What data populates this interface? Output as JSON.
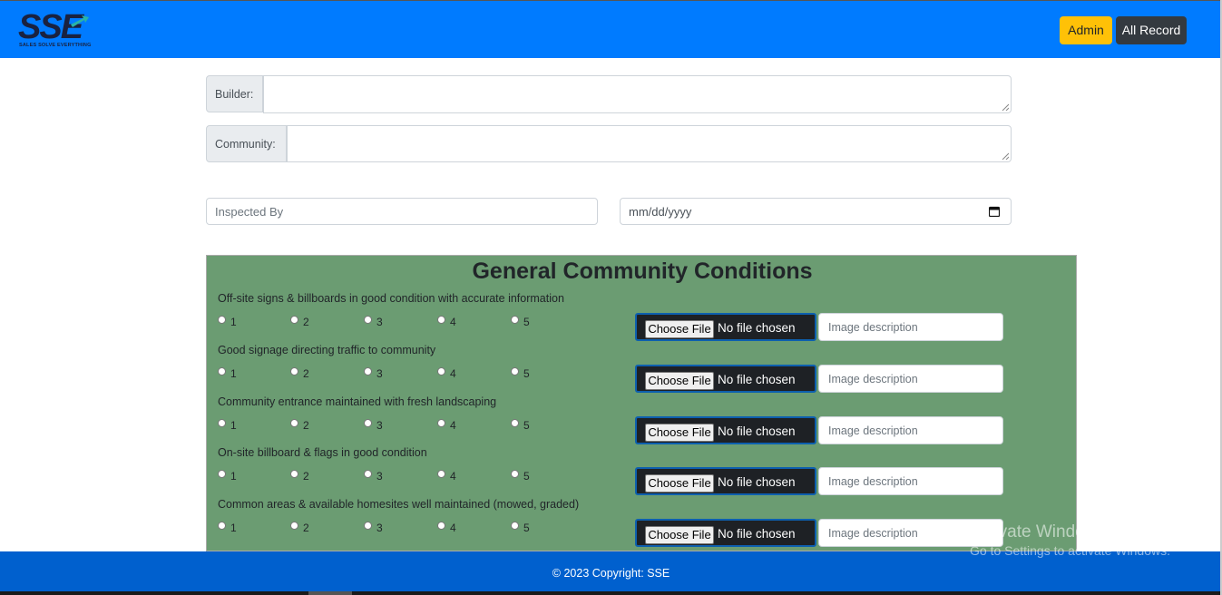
{
  "header": {
    "logo_text": "SSE",
    "logo_tagline": "SALES SOLVE EVERYTHING",
    "admin_label": "Admin",
    "all_record_label": "All Record"
  },
  "form": {
    "builder_label": "Builder:",
    "community_label": "Community:",
    "inspected_by_placeholder": "Inspected By",
    "date_placeholder": "mm/dd/yyyy"
  },
  "section": {
    "title": "General Community Conditions",
    "rating_options": [
      "1",
      "2",
      "3",
      "4",
      "5"
    ],
    "file_button_label": "Choose File",
    "file_status": "No file chosen",
    "image_desc_placeholder": "Image description",
    "questions": [
      "Off-site signs & billboards in good condition with accurate information",
      "Good signage directing traffic to community",
      "Community entrance maintained with fresh landscaping",
      "On-site billboard & flags in good condition",
      "Common areas & available homesites well maintained (mowed, graded)"
    ]
  },
  "footer": {
    "copyright": "© 2023 Copyright: SSE"
  },
  "watermark": {
    "line1": "Activate Windows",
    "line2": "Go to Settings to activate Windows."
  },
  "colors": {
    "navbar": "#007bff",
    "admin_button": "#ffc107",
    "all_record_button": "#343a40",
    "panel": "#6b9c72",
    "footer": "#0060ce"
  }
}
